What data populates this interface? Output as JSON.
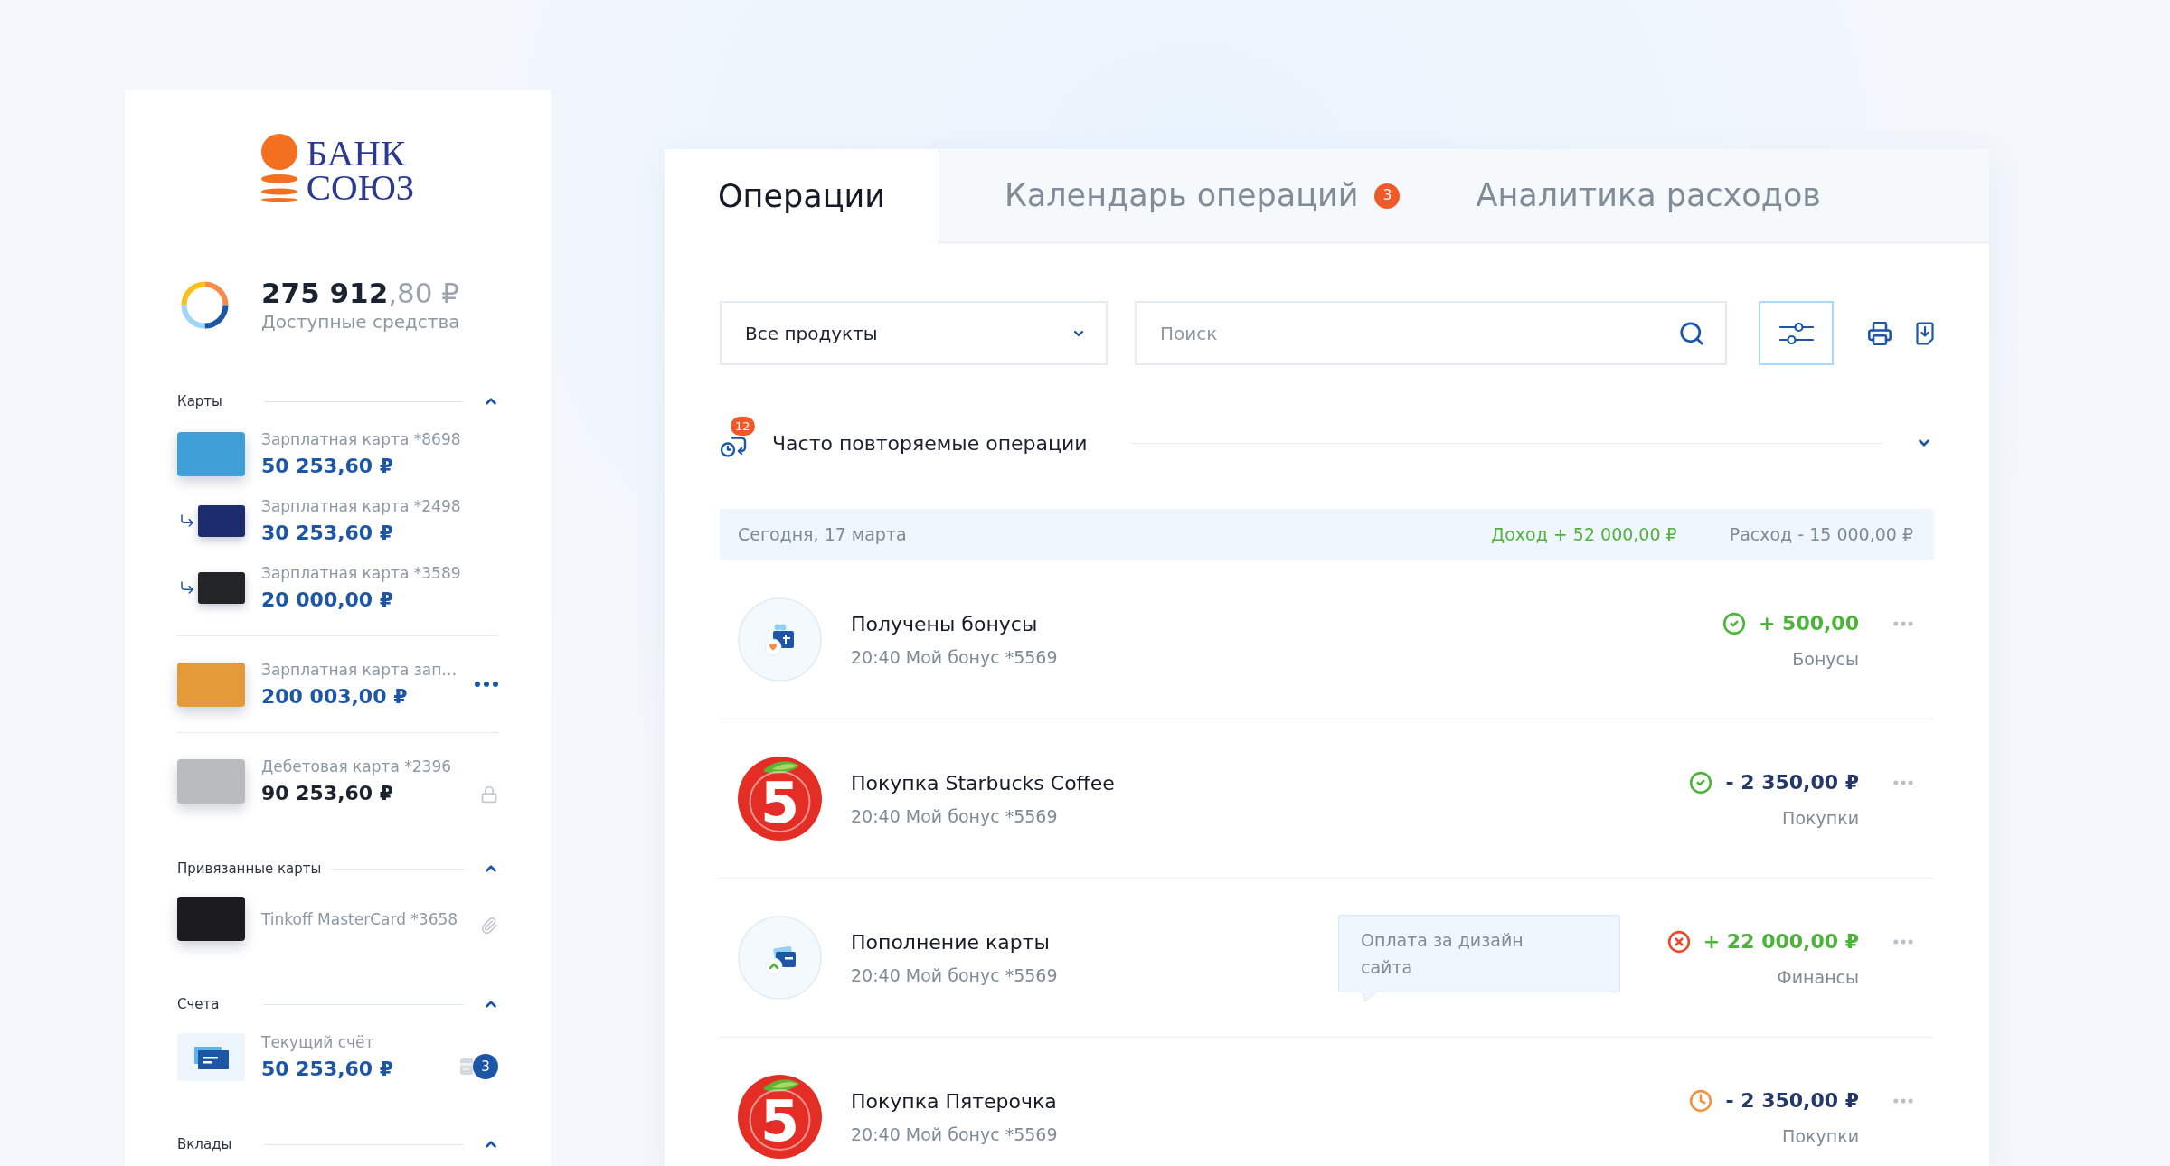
{
  "sidebar": {
    "logo_lines": [
      "БАНК",
      "СОЮЗ"
    ],
    "balance": {
      "amount": "**275 912**,80 ₽",
      "label": "Доступные средства"
    },
    "sections": [
      {
        "title": "Карты",
        "expanded": true,
        "items": [
          {
            "kind": "card",
            "name": "Зарплатная карта *8698",
            "amount": "50 253,60 ₽",
            "color": "#3f9fd6",
            "locked": false,
            "menu": false,
            "children": [
              {
                "kind": "card",
                "name": "Зарплатная карта *2498",
                "amount": "30 253,60 ₽",
                "color": "#1b2d6e",
                "locked": false,
                "menu": false
              },
              {
                "kind": "card",
                "name": "Зарплатная карта *3589",
                "amount": "20 000,00 ₽",
                "color": "#222426",
                "locked": false,
                "menu": false
              }
            ]
          },
          {
            "kind": "card",
            "name": "Зарплатная карта зап…",
            "amount": "200 003,00 ₽",
            "color": "#e49a38",
            "locked": false,
            "menu": true
          },
          {
            "kind": "card",
            "name": "Дебетовая карта *2396",
            "amount": "90 253,60 ₽",
            "color": "#b9bcbf",
            "locked": true,
            "menu": false
          }
        ]
      },
      {
        "title": "Привязанные карты",
        "expanded": true,
        "items": [
          {
            "kind": "linked_card",
            "name": "Tinkoff MasterCard *3658",
            "color": "#1c1c1e"
          }
        ]
      },
      {
        "title": "Счета",
        "expanded": true,
        "items": [
          {
            "kind": "account",
            "name": "Текущий счёт",
            "amount": "50 253,60 ₽",
            "badge": "3"
          }
        ]
      },
      {
        "title": "Вклады",
        "expanded": true
      }
    ]
  },
  "tabs": [
    {
      "label": "Операции",
      "selected": true
    },
    {
      "label": "Календарь операций",
      "selected": false,
      "badge": "3"
    },
    {
      "label": "Аналитика расходов",
      "selected": false
    }
  ],
  "toolbar": {
    "product_select": {
      "value": "Все продукты"
    },
    "search": {
      "placeholder": "Поиск"
    },
    "filter_button": {
      "active": true
    }
  },
  "frequent": {
    "title": "Часто повторяемые операции",
    "count": "12",
    "expanded": false
  },
  "day": {
    "date": "Сегодня, 17 марта",
    "income": "Доход + 52 000,00 ₽",
    "expense": "Расход - 15 000,00 ₽"
  },
  "operations": [
    {
      "kind": "bonus",
      "title": "Получены бонусы",
      "subtitle": "20:40 Мой бонус *5569",
      "status": {
        "kind": "done"
      },
      "amount": "+ 500,00",
      "income": true,
      "category": "Бонусы"
    },
    {
      "kind": "store",
      "logo_text": "5",
      "title": "Покупка Starbucks Coffee",
      "subtitle": "20:40 Мой бонус *5569",
      "status": {
        "kind": "done"
      },
      "amount": "- 2 350,00 ₽",
      "income": false,
      "category": "Покупки"
    },
    {
      "kind": "topup",
      "title": "Пополнение карты",
      "subtitle": "20:40 Мой бонус *5569",
      "note": "Оплата за дизайн сайта",
      "status": {
        "kind": "failed"
      },
      "amount": "+ 22 000,00 ₽",
      "income": true,
      "category": "Финансы"
    },
    {
      "kind": "store",
      "logo_text": "5",
      "title": "Покупка Пятерочка",
      "subtitle": "20:40 Мой бонус *5569",
      "status": {
        "kind": "pending"
      },
      "amount": "- 2 350,00 ₽",
      "income": false,
      "category": "Покупки"
    }
  ]
}
